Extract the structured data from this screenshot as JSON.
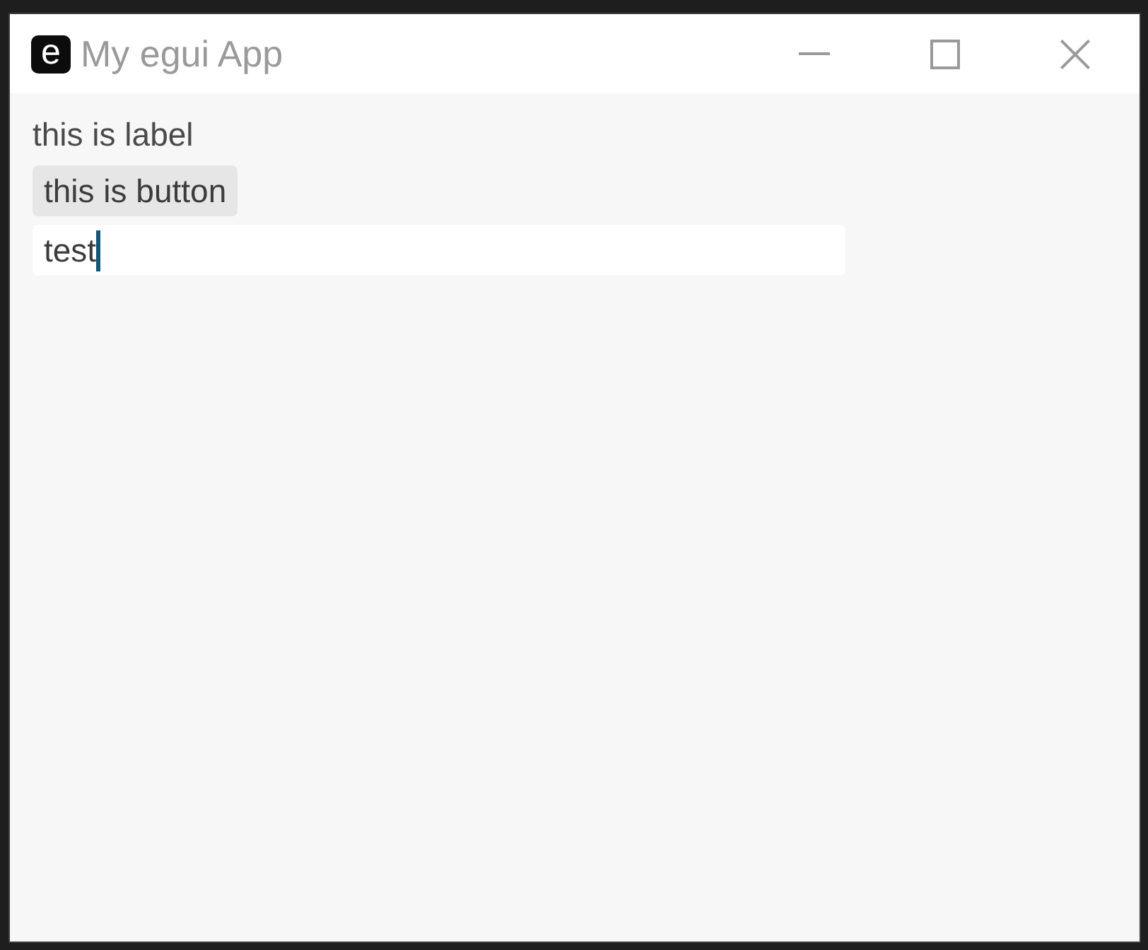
{
  "window": {
    "icon_letter": "e",
    "title": "My egui App",
    "controls": [
      {
        "kind": "minimize"
      },
      {
        "kind": "maximize"
      },
      {
        "kind": "close"
      }
    ]
  },
  "content": [
    {
      "kind": "label",
      "text": "this is label"
    },
    {
      "kind": "button",
      "text": "this is button"
    },
    {
      "kind": "text_input",
      "value": "test",
      "focused": true
    }
  ]
}
